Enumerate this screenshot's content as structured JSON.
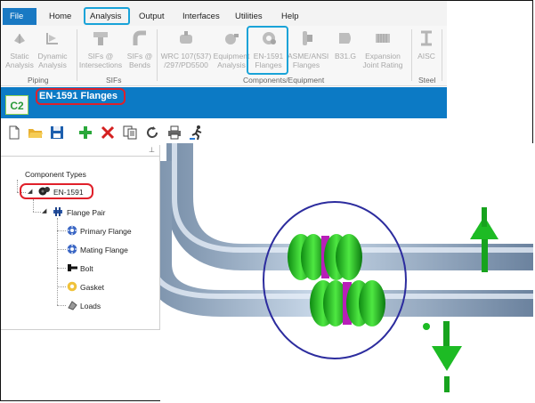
{
  "menu": {
    "file": "File",
    "items": [
      "Home",
      "Analysis",
      "Output",
      "Interfaces",
      "Utilities",
      "Help"
    ]
  },
  "ribbon": {
    "buttons": [
      {
        "line1": "Static",
        "line2": "Analysis"
      },
      {
        "line1": "Dynamic",
        "line2": "Analysis"
      },
      {
        "line1": "SIFs @",
        "line2": "Intersections"
      },
      {
        "line1": "SIFs @",
        "line2": "Bends"
      },
      {
        "line1": "WRC 107(537)",
        "line2": "/297/PD5500"
      },
      {
        "line1": "Equipment",
        "line2": "Analysis"
      },
      {
        "line1": "EN-1591",
        "line2": "Flanges"
      },
      {
        "line1": "ASME/ANSI",
        "line2": "Flanges"
      },
      {
        "line1": "B31.G",
        "line2": ""
      },
      {
        "line1": "Expansion",
        "line2": "Joint Rating"
      },
      {
        "line1": "AISC",
        "line2": ""
      }
    ],
    "groups": [
      "Piping",
      "SIFs",
      "Components/Equipment",
      "Steel"
    ]
  },
  "titlebar": {
    "logo": "C2",
    "title": "EN-1591 Flanges"
  },
  "toolbar": {
    "icons": [
      "new-file-icon",
      "open-folder-icon",
      "save-icon",
      "add-icon",
      "delete-icon",
      "copy-icon",
      "refresh-icon",
      "print-icon",
      "run-analysis-icon"
    ]
  },
  "tree": {
    "pin": "⊥",
    "root": "Component Types",
    "en1591": "EN-1591",
    "flange_pair": "Flange Pair",
    "children": [
      "Primary Flange",
      "Mating Flange",
      "Bolt",
      "Gasket",
      "Loads"
    ]
  },
  "colors": {
    "accent": "#0c7ac5",
    "highlight_blue": "#19a3d8",
    "highlight_red": "#e0202a",
    "flange_green": "#22c21e",
    "gasket_magenta": "#b520b5"
  }
}
